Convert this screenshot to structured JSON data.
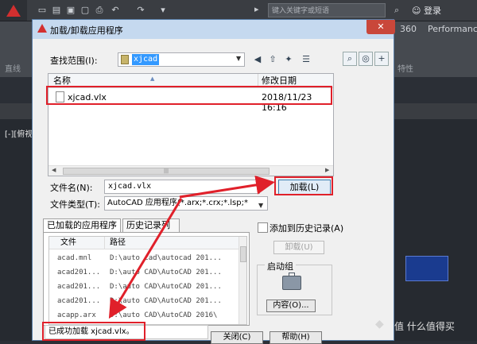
{
  "app": {
    "search_placeholder": "键入关键字或短语",
    "sign_in": "登录",
    "ribbon_tab_360": "360",
    "ribbon_tab_performance": "Performance",
    "ribbon_label_line": "直线",
    "ribbon_label_properties": "特性",
    "viewport_label": "[-][俯视"
  },
  "dialog": {
    "title": "加载/卸载应用程序",
    "lookin_label": "查找范围(I):",
    "lookin_value": "xjcad",
    "file_list": {
      "col_name": "名称",
      "col_date": "修改日期",
      "files": [
        {
          "name": "xjcad.vlx",
          "date": "2018/11/23 16:16"
        }
      ]
    },
    "filename_label": "文件名(N):",
    "filename_value": "xjcad.vlx",
    "filetype_label": "文件类型(T):",
    "filetype_value": "AutoCAD 应用程序(*.arx;*.crx;*.lsp;*",
    "load_button": "加载(L)",
    "tabs": {
      "loaded": "已加载的应用程序",
      "history": "历史记录列表"
    },
    "loaded_table": {
      "col_file": "文件",
      "col_path": "路径",
      "rows": [
        {
          "file": "acad.mnl",
          "path": "D:\\auto    cad\\autocad 201..."
        },
        {
          "file": "acad201...",
          "path": "D:\\auto    CAD\\AutoCAD 201..."
        },
        {
          "file": "acad201...",
          "path": "D:\\auto    CAD\\AutoCAD 201..."
        },
        {
          "file": "acad201...",
          "path": "D:\\auto    CAD\\AutoCAD 201..."
        },
        {
          "file": "acapp.arx",
          "path": "D:\\auto    CAD\\AutoCAD 2016\\"
        }
      ]
    },
    "add_history_label": "添加到历史记录(A)",
    "unload_button": "卸载(U)",
    "startup_suite_label": "启动组",
    "contents_button": "内容(O)...",
    "status_text": "已成功加载 xjcad.vlx。",
    "close_button": "关闭(C)",
    "help_button": "帮助(H)"
  },
  "watermark": "值 什么值得买",
  "colors": {
    "highlight_red": "#e0202a",
    "selection_blue": "#3399ff",
    "titlebar": "#c5d9ef"
  }
}
